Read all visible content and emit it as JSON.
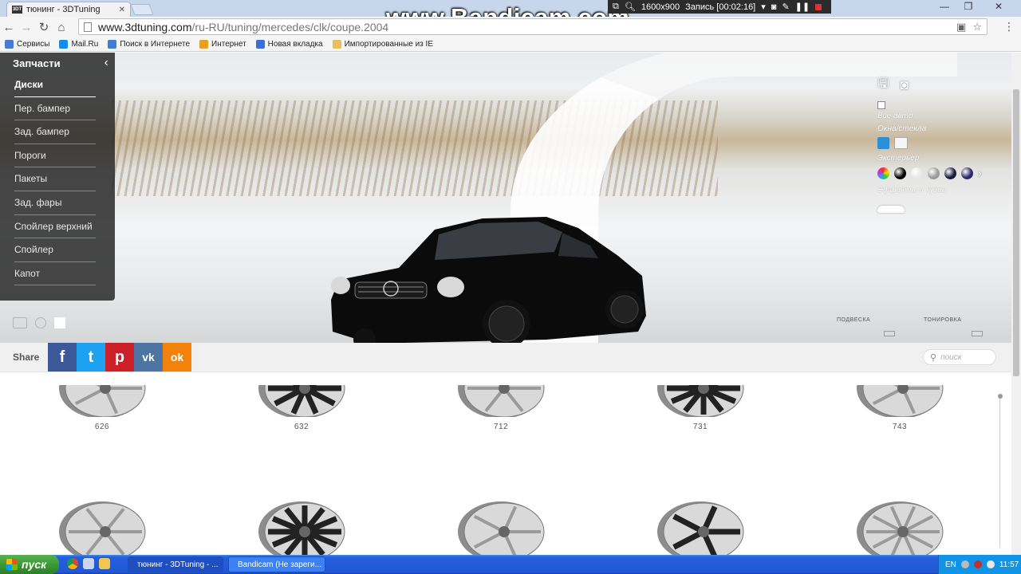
{
  "browser": {
    "tab_title": "тюнинг - 3DTuning",
    "tab_favicon": "3DT",
    "url_host": "www.3dtuning.com",
    "url_path": "/ru-RU/tuning/mercedes/clk/coupe.2004"
  },
  "recording": {
    "watermark": "www.Bandicam.com",
    "resolution": "1600x900",
    "status": "Запись [00:02:16]"
  },
  "bookmarks": [
    {
      "label": "Сервисы",
      "color": "#4a7bd0"
    },
    {
      "label": "Mail.Ru",
      "color": "#168de2"
    },
    {
      "label": "Поиск в Интернете",
      "color": "#3f7ed6"
    },
    {
      "label": "Интернет",
      "color": "#e6a020"
    },
    {
      "label": "Новая вкладка",
      "color": "#3a6fd8"
    },
    {
      "label": "Импортированные из IE",
      "color": "#e8c060"
    }
  ],
  "sidebar": {
    "title": "Запчасти",
    "items": [
      {
        "label": "Диски"
      },
      {
        "label": "Пер. бампер"
      },
      {
        "label": "Зад. бампер"
      },
      {
        "label": "Пороги"
      },
      {
        "label": "Пакеты"
      },
      {
        "label": "Зад. фары"
      },
      {
        "label": "Спойлер верхний"
      },
      {
        "label": "Спойлер"
      },
      {
        "label": "Капот"
      }
    ]
  },
  "right_panel": {
    "all_cars": "Все авто",
    "windows": "Окна/стекла",
    "exterior": "Экстерьер",
    "effects": "Эффекты и кузов",
    "swatch_colors": [
      "#6a8a5a",
      "#000000",
      "#e8e8e8",
      "#9a9a9a",
      "#1a1a3a",
      "#2a2a6a"
    ]
  },
  "hero_labels": {
    "suspension": "ПОДВЕСКА",
    "tint": "ТОНИРОВКА"
  },
  "share": {
    "label": "Share",
    "buttons": [
      {
        "name": "facebook",
        "glyph": "f",
        "color": "#3b5998"
      },
      {
        "name": "twitter",
        "glyph": "t",
        "color": "#1da1f2"
      },
      {
        "name": "pinterest",
        "glyph": "p",
        "color": "#cb2027"
      },
      {
        "name": "vk",
        "glyph": "vk",
        "color": "#4c75a3"
      },
      {
        "name": "odnoklassniki",
        "glyph": "ok",
        "color": "#f2820a"
      }
    ],
    "search_placeholder": "поиск"
  },
  "rims_row1": [
    "626",
    "632",
    "712",
    "731",
    "743"
  ],
  "taskbar": {
    "start": "пуск",
    "tasks": [
      "тюнинг - 3DTuning - ...",
      "Bandicam (Не зареги..."
    ],
    "lang": "EN",
    "clock": "11:57"
  }
}
